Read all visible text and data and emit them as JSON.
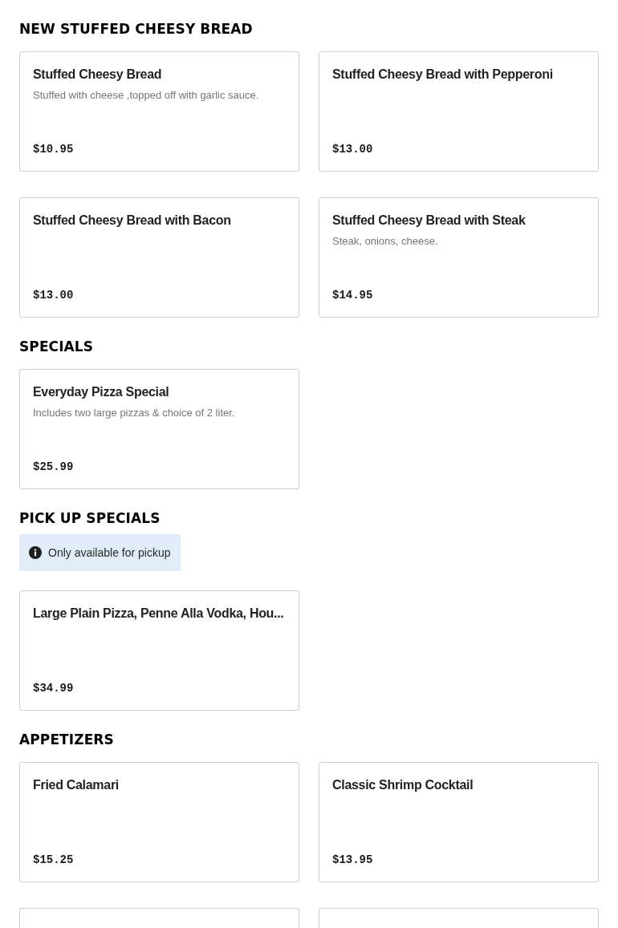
{
  "sections": [
    {
      "title": "NEW STUFFED CHEESY BREAD",
      "items": [
        {
          "kind": "full",
          "name": "Stuffed Cheesy Bread",
          "description": "Stuffed with cheese ,topped off with garlic sauce.",
          "price": "$10.95"
        },
        {
          "kind": "full",
          "name": "Stuffed Cheesy Bread with Pepperoni",
          "price": "$13.00"
        },
        {
          "kind": "full",
          "name": "Stuffed Cheesy Bread with Bacon",
          "price": "$13.00"
        },
        {
          "kind": "full",
          "name": "Stuffed Cheesy Bread with Steak",
          "description": "Steak, onions, cheese.",
          "price": "$14.95"
        }
      ]
    },
    {
      "title": "SPECIALS",
      "items": [
        {
          "kind": "full",
          "name": "Everyday Pizza Special",
          "description": "Includes two large pizzas & choice of 2 liter.",
          "price": "$25.99"
        }
      ]
    },
    {
      "title": "PICK UP SPECIALS",
      "notice": {
        "text": "Only available for pickup"
      },
      "items": [
        {
          "kind": "full",
          "name": "Large Plain Pizza, Penne Alla Vodka, Hou...",
          "price": "$34.99"
        }
      ]
    },
    {
      "title": "APPETIZERS",
      "items": [
        {
          "kind": "full",
          "name": "Fried Calamari",
          "price": "$15.25"
        },
        {
          "kind": "full",
          "name": "Classic Shrimp Cocktail",
          "price": "$13.95"
        },
        {
          "kind": "cut_off"
        },
        {
          "kind": "cut_off"
        }
      ]
    }
  ]
}
